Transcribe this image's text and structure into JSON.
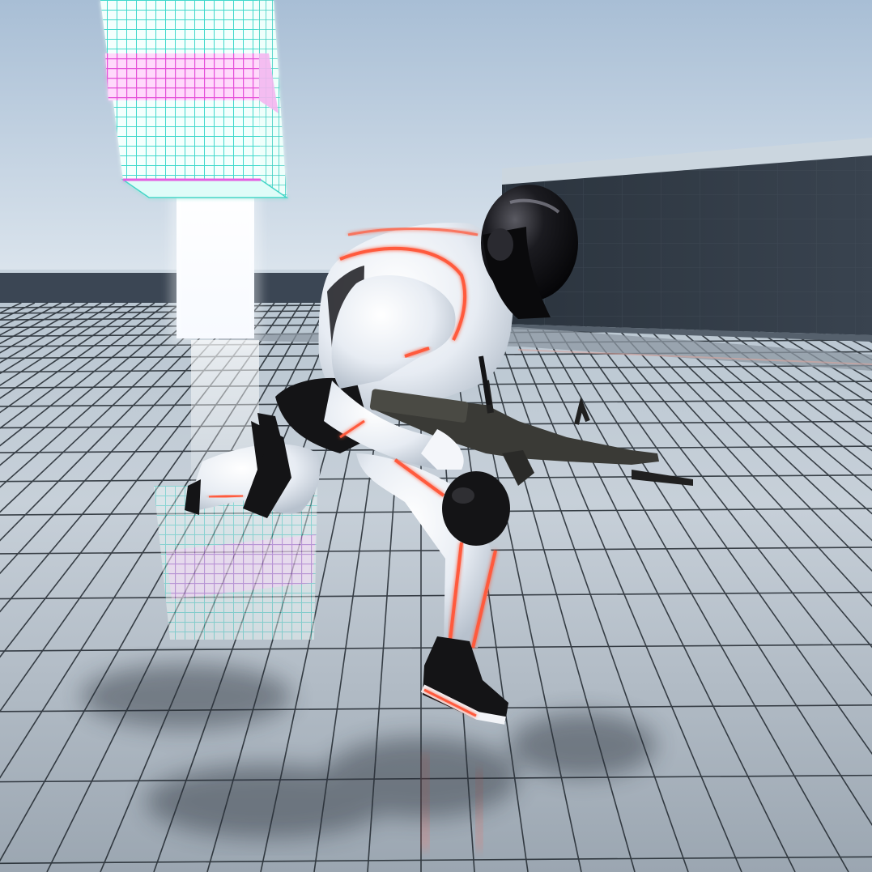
{
  "scene": {
    "type": "third-person game viewport",
    "hud": []
  },
  "colors": {
    "sky_top": "#a9bfd6",
    "sky_bottom": "#e6edf2",
    "floor_light": "#c8d2db",
    "floor_dark": "#6e7a86",
    "grid_line": "#1e242b",
    "wall": "#2f3843",
    "wall_cap": "#c6d2dc",
    "neon_cyan": "#4be3d6",
    "neon_magenta": "#e45fe0",
    "neon_orange": "#ff5a3c",
    "body_white": "#eef1f6",
    "armor_black": "#141416",
    "gun": "#3a3a36"
  }
}
